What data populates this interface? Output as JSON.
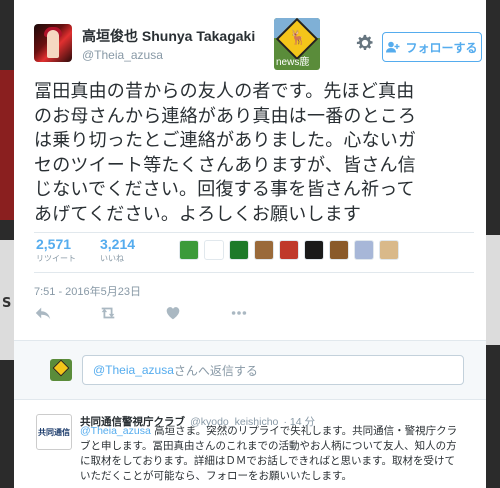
{
  "author": {
    "display_name": "高垣俊也 Shunya Takagaki",
    "handle": "@Theia_azusa",
    "badge_label": "news鹿"
  },
  "follow_button": {
    "label": "フォローする"
  },
  "tweet": {
    "lines": [
      "冨田真由の昔からの友人の者です。先ほど真由",
      "のお母さんから連絡があり真由は一番のところ",
      "は乗り切ったとご連絡がありました。心ないガ",
      "セのツイート等たくさんありますが、皆さん信",
      "じないでください。回復する事を皆さん祈って",
      "あげてください。よろしくお願いします"
    ],
    "retweets": {
      "count": "2,571",
      "label": "リツイート"
    },
    "likes": {
      "count": "3,214",
      "label": "いいね"
    },
    "timestamp": "7:51 - 2016年5月23日"
  },
  "liker_colors": [
    "#3b9a3b",
    "#ffffff",
    "#1d7a2a",
    "#9a6a3a",
    "#c0392b",
    "#1a1a1a",
    "#8a5a2a",
    "#a7b7d8",
    "#d9b98a"
  ],
  "reply_box": {
    "mention": "@Theia_azusa",
    "placeholder_suffix": "さんへ返信する"
  },
  "reply": {
    "avatar_text": "共同通信",
    "name": "共同通信警視庁クラブ",
    "handle": "@kyodo_keishicho",
    "time": "· 14 分",
    "mention": "@Theia_azusa",
    "first_line_rest": " 高垣さま。突然のリプライで失礼します。共同通信・警視庁クラ",
    "lines": [
      "ブと申します。冨田真由さんのこれまでの活動やお人柄について友人、知人の方",
      "に取材をしております。詳細はＤＭでお話しできればと思います。取材を受けて",
      "いただくことが可能なら、フォローをお願いいたします。"
    ]
  }
}
